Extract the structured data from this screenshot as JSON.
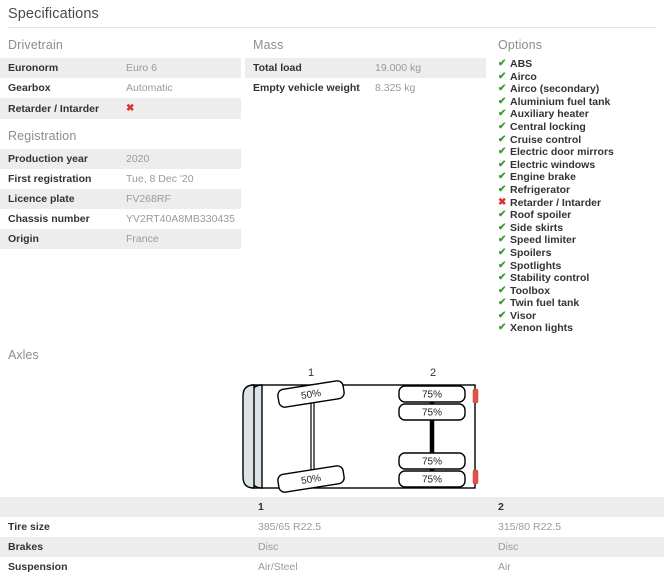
{
  "header": {
    "title": "Specifications"
  },
  "drivetrain": {
    "heading": "Drivetrain",
    "rows": [
      {
        "label": "Euronorm",
        "value": "Euro 6",
        "type": "text"
      },
      {
        "label": "Gearbox",
        "value": "Automatic",
        "type": "text"
      },
      {
        "label": "Retarder / Intarder",
        "value": "✖",
        "type": "cross"
      }
    ]
  },
  "registration": {
    "heading": "Registration",
    "rows": [
      {
        "label": "Production year",
        "value": "2020"
      },
      {
        "label": "First registration",
        "value": "Tue, 8 Dec '20"
      },
      {
        "label": "Licence plate",
        "value": "FV268RF"
      },
      {
        "label": "Chassis number",
        "value": "YV2RT40A8MB330435"
      },
      {
        "label": "Origin",
        "value": "France"
      }
    ]
  },
  "mass": {
    "heading": "Mass",
    "rows": [
      {
        "label": "Total load",
        "value": "19.000 kg"
      },
      {
        "label": "Empty vehicle weight",
        "value": "8.325 kg"
      }
    ]
  },
  "options": {
    "heading": "Options",
    "check_glyph": "✔",
    "cross_glyph": "✖",
    "check_color": "#3d9b35",
    "cross_color": "#d8352a",
    "items": [
      {
        "label": "ABS",
        "available": true
      },
      {
        "label": "Airco",
        "available": true
      },
      {
        "label": "Airco (secondary)",
        "available": true
      },
      {
        "label": "Aluminium fuel tank",
        "available": true
      },
      {
        "label": "Auxiliary heater",
        "available": true
      },
      {
        "label": "Central locking",
        "available": true
      },
      {
        "label": "Cruise control",
        "available": true
      },
      {
        "label": "Electric door mirrors",
        "available": true
      },
      {
        "label": "Electric windows",
        "available": true
      },
      {
        "label": "Engine brake",
        "available": true
      },
      {
        "label": "Refrigerator",
        "available": true
      },
      {
        "label": "Retarder / Intarder",
        "available": false
      },
      {
        "label": "Roof spoiler",
        "available": true
      },
      {
        "label": "Side skirts",
        "available": true
      },
      {
        "label": "Speed limiter",
        "available": true
      },
      {
        "label": "Spoilers",
        "available": true
      },
      {
        "label": "Spotlights",
        "available": true
      },
      {
        "label": "Stability control",
        "available": true
      },
      {
        "label": "Toolbox",
        "available": true
      },
      {
        "label": "Twin fuel tank",
        "available": true
      },
      {
        "label": "Visor",
        "available": true
      },
      {
        "label": "Xenon lights",
        "available": true
      }
    ]
  },
  "axles": {
    "heading": "Axles",
    "diagram": {
      "axle_numbers": [
        "1",
        "2"
      ],
      "axle1_tread": [
        "50%",
        "50%"
      ],
      "axle2_tread": [
        "75%",
        "75%",
        "75%",
        "75%"
      ],
      "body_color": "#ffffff",
      "outline_color": "#000000",
      "cab_fill": "#dce3e8",
      "marker_color": "#e2544a"
    },
    "table": {
      "columns": [
        "",
        "1",
        "2"
      ],
      "rows": [
        {
          "label": "Tire size",
          "axle1": "385/65 R22.5",
          "axle2": "315/80 R22.5"
        },
        {
          "label": "Brakes",
          "axle1": "Disc",
          "axle2": "Disc"
        },
        {
          "label": "Suspension",
          "axle1": "Air/Steel",
          "axle2": "Air"
        }
      ]
    }
  }
}
